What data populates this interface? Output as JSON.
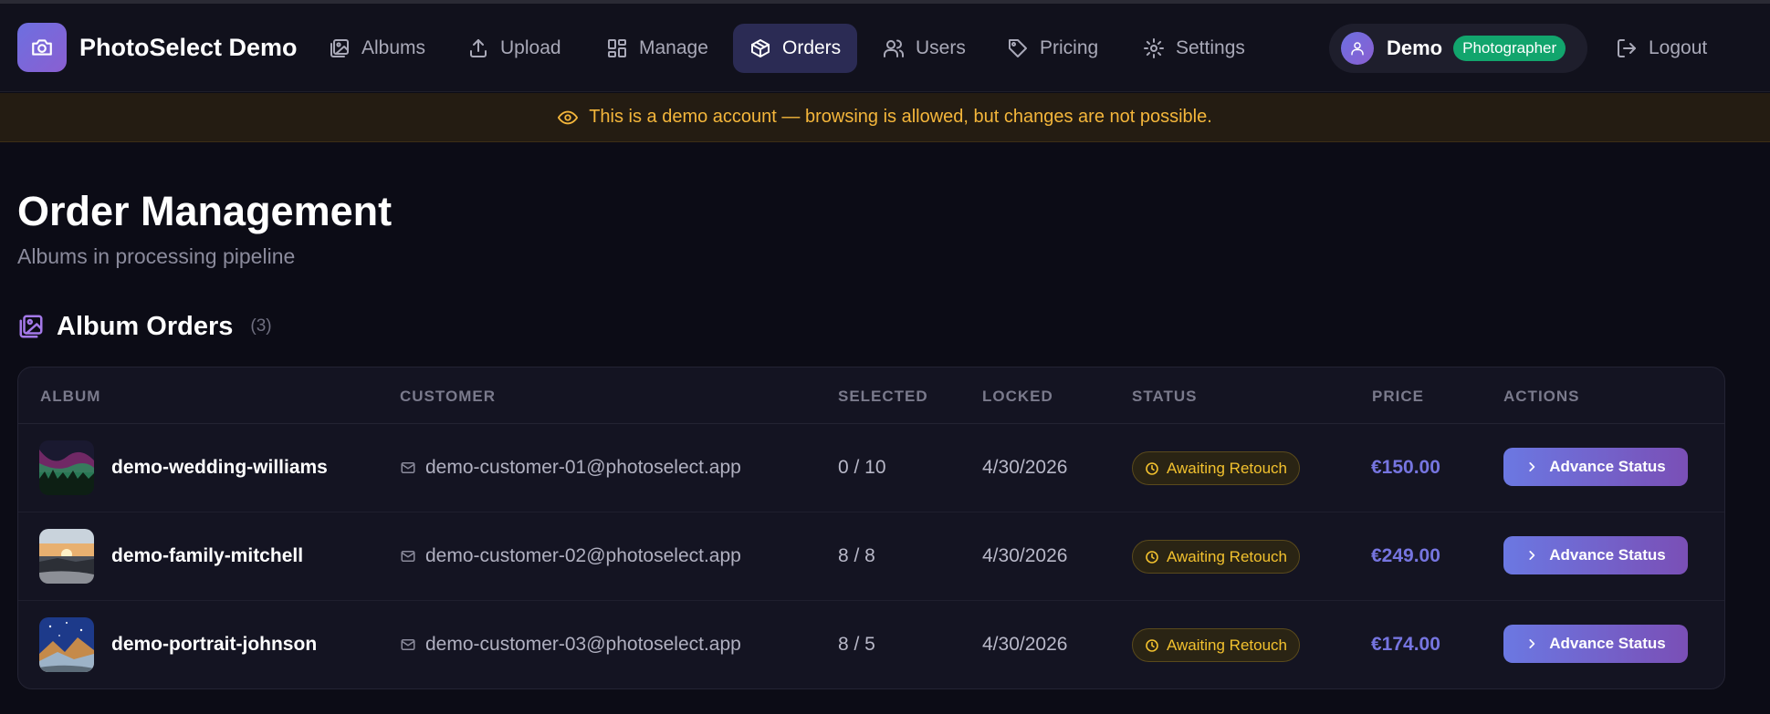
{
  "header": {
    "brand": "PhotoSelect Demo",
    "nav": [
      {
        "label": "Albums",
        "icon": "albums-icon"
      },
      {
        "label": "Upload",
        "icon": "upload-icon"
      },
      {
        "label": "Manage",
        "icon": "manage-icon"
      },
      {
        "label": "Orders",
        "icon": "package-icon",
        "active": true
      },
      {
        "label": "Users",
        "icon": "users-icon"
      },
      {
        "label": "Pricing",
        "icon": "tag-icon"
      },
      {
        "label": "Settings",
        "icon": "gear-icon"
      }
    ],
    "user": {
      "name": "Demo",
      "role": "Photographer"
    },
    "logout_label": "Logout"
  },
  "banner": {
    "text": "This is a demo account — browsing is allowed, but changes are not possible."
  },
  "page": {
    "title": "Order Management",
    "subtitle": "Albums in processing pipeline"
  },
  "section": {
    "title": "Album Orders",
    "count": "(3)"
  },
  "table": {
    "columns": [
      "ALBUM",
      "CUSTOMER",
      "SELECTED",
      "LOCKED",
      "STATUS",
      "PRICE",
      "ACTIONS"
    ],
    "rows": [
      {
        "album": "demo-wedding-williams",
        "customer": "demo-customer-01@photoselect.app",
        "selected": "0 / 10",
        "locked": "4/30/2026",
        "status": "Awaiting Retouch",
        "price": "€150.00",
        "action": "Advance Status"
      },
      {
        "album": "demo-family-mitchell",
        "customer": "demo-customer-02@photoselect.app",
        "selected": "8 / 8",
        "locked": "4/30/2026",
        "status": "Awaiting Retouch",
        "price": "€249.00",
        "action": "Advance Status"
      },
      {
        "album": "demo-portrait-johnson",
        "customer": "demo-customer-03@photoselect.app",
        "selected": "8 / 5",
        "locked": "4/30/2026",
        "status": "Awaiting Retouch",
        "price": "€174.00",
        "action": "Advance Status"
      }
    ]
  },
  "colors": {
    "accent": "#6d6fe0",
    "active_nav": "#2b2b54",
    "warning": "#f4b63b",
    "status": "#f2c12e",
    "role_badge": "#12a56d",
    "price": "#7675e0"
  }
}
